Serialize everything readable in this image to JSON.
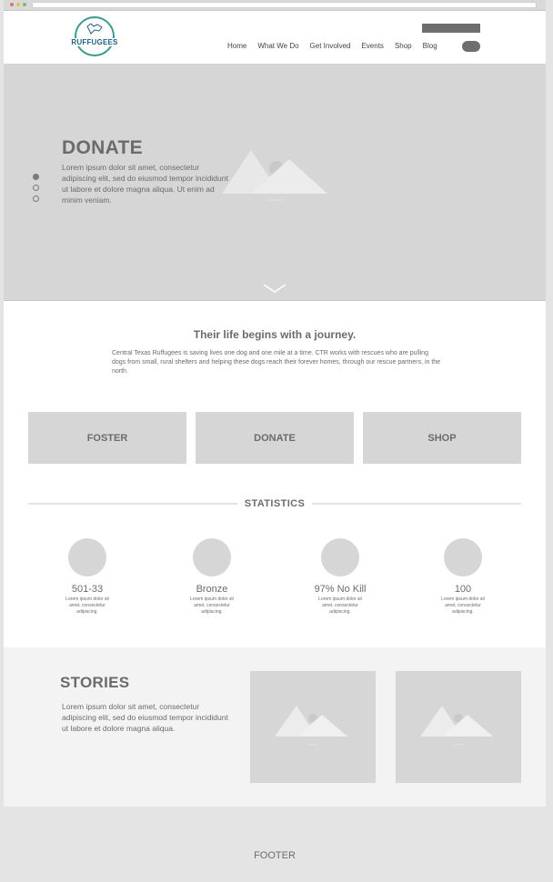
{
  "header": {
    "logo_text": "RUFFUGEES",
    "nav": [
      "Home",
      "What We Do",
      "Get Involved",
      "Events",
      "Shop",
      "Blog"
    ]
  },
  "hero": {
    "title": "DONATE",
    "text": "Lorem ipsum dolor sit amet, consectetur adipiscing elit, sed do eiusmod tempor incididunt ut labore et dolore magna aliqua. Ut enim ad minim veniam.",
    "slide_count": 3,
    "active_slide": 1
  },
  "journey": {
    "title": "Their life begins with a journey.",
    "text": "Central Texas Ruffugees is saving lives one dog and one mile at a time.  CTR works with rescues who are pulling dogs from small, rural shelters and helping these dogs reach their forever homes, through our rescue partners, in the north."
  },
  "cta": [
    "FOSTER",
    "DONATE",
    "SHOP"
  ],
  "statistics": {
    "heading": "STATISTICS",
    "items": [
      {
        "value": "501-33",
        "desc": "Lorem ipsum dolor sit amet, consectetur adipiscing."
      },
      {
        "value": "Bronze",
        "desc": "Lorem ipsum dolor sit amet, consectetur adipiscing."
      },
      {
        "value": "97% No Kill",
        "desc": "Lorem ipsum dolor sit amet, consectetur adipiscing."
      },
      {
        "value": "100",
        "desc": "Lorem ipsum dolor sit amet, consectetur adipiscing."
      }
    ]
  },
  "stories": {
    "title": "STORIES",
    "text": "Lorem ipsum dolor sit amet, consectetur adipiscing elit, sed do eiusmod tempor incididunt ut labore et dolore magna aliqua."
  },
  "footer": {
    "text": "FOOTER"
  },
  "colors": {
    "logo_ring": "#3a9a8c",
    "logo_text": "#1f5f86",
    "placeholder": "#d6d6d6"
  }
}
